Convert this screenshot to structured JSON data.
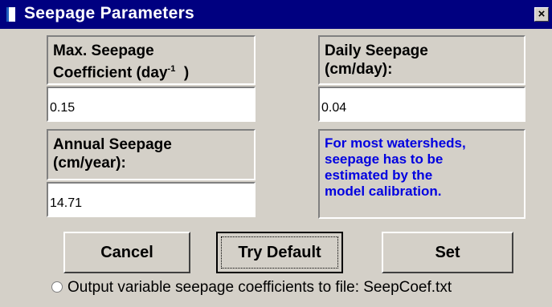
{
  "window": {
    "title": "Seepage Parameters",
    "close_label": "×"
  },
  "fields": {
    "max_coef": {
      "label_line1": "Max. Seepage",
      "label_line2": "Coefficient (day",
      "label_sup": "-1",
      "label_end": "  )",
      "value": "0.15"
    },
    "daily": {
      "label_line1": "Daily Seepage",
      "label_line2": "(cm/day):",
      "value": "0.04"
    },
    "annual": {
      "label_line1": "Annual Seepage",
      "label_line2": "(cm/year):",
      "value": "14.71"
    }
  },
  "note": {
    "line1": "For most watersheds,",
    "line2": "seepage has to be",
    "line3": "estimated by the",
    "line4": "model calibration."
  },
  "buttons": {
    "cancel": "Cancel",
    "try_default": "Try Default",
    "set": "Set"
  },
  "option": {
    "label": "Output variable seepage coefficients to file: SeepCoef.txt",
    "checked": false
  },
  "colors": {
    "title_bar": "#000080",
    "note_text": "#0000e0",
    "face": "#d4d0c8"
  }
}
